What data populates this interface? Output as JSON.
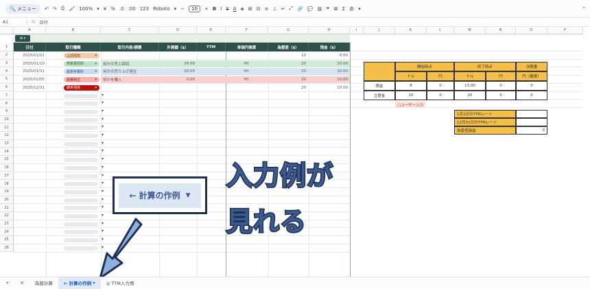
{
  "toolbar": {
    "menu_label": "メニュー",
    "zoom": "100%",
    "currency": "¥",
    "percent": "%",
    "dec_dec": ".0",
    "dec_inc": ".00",
    "number_format": "123",
    "font": "Roboto",
    "font_size": "10",
    "bold": "B",
    "italic": "I",
    "strike": "S",
    "text_color": "A",
    "sigma": "Σ",
    "input_tool": "あ"
  },
  "formula_bar": {
    "cell_ref": "A1",
    "fx": "fx",
    "value": "日付"
  },
  "columns": [
    "A",
    "B",
    "C",
    "D",
    "E",
    "F",
    "G",
    "H",
    "I",
    "J",
    "K",
    "L",
    "M",
    "N",
    "O",
    "P"
  ],
  "rows": [
    "1",
    "2",
    "3",
    "4",
    "5",
    "6",
    "7",
    "8",
    "9",
    "10",
    "11",
    "12",
    "13",
    "14",
    "15",
    "16",
    "17",
    "18",
    "19",
    "20",
    "21",
    "22",
    "23",
    "24",
    "25",
    "26"
  ],
  "headers": [
    "日付",
    "取引種類",
    "取引内容/摘要",
    "外貨額（$）",
    "TTM",
    "単価円換算",
    "為替差（$）",
    "残金（$）"
  ],
  "table": [
    {
      "date": "2025/01/01",
      "type": "以前残高",
      "desc": "",
      "amount": "",
      "ttm": "",
      "yen": "",
      "fx": "10",
      "bal": "8.00"
    },
    {
      "date": "2025/01/10",
      "type": "売掛金回収",
      "desc": "何かの売上回収",
      "amount": "16.00",
      "ttm": "",
      "yen": "¥0",
      "fx": "20",
      "bal": "10.00"
    },
    {
      "date": "2025/01/31",
      "type": "仮想手数料",
      "desc": "何かの売り上げ発生",
      "amount": "20.00",
      "ttm": "",
      "yen": "¥0",
      "fx": "20",
      "bal": "10.00"
    },
    {
      "date": "2025/02/05",
      "type": "経費発生",
      "desc": "何かを購入",
      "amount": "0.00",
      "ttm": "",
      "yen": "¥0",
      "fx": "20",
      "bal": "10.00"
    },
    {
      "date": "2025/12/31",
      "type": "期末残高",
      "desc": "",
      "amount": "",
      "ttm": "",
      "yen": "",
      "fx": "20",
      "bal": "10.00"
    }
  ],
  "summary": {
    "start": "開始時点",
    "end": "終了時点",
    "closing": "決算書",
    "dollar": "ドル",
    "yen": "円",
    "yen2": "円",
    "dollar2": "ドル",
    "yen3": "円",
    "yen_diff": "円（概算）",
    "r1": "預金",
    "r1_sd": "8",
    "r1_sy": "0",
    "r1_ed": "13.00",
    "r1_ey": "0",
    "r1_cy": "0",
    "r2": "立替金",
    "r2_sd": "10",
    "r2_sy": "0",
    "r2_ed": "20",
    "r2_ey": "0",
    "r2_cy": "0",
    "user_input": "□ユーザー入力"
  },
  "ttm": {
    "r1": "1月1日のTTMレート",
    "r2": "12月31日のTTMレート",
    "r3": "為替差損益",
    "r3_val": "0"
  },
  "dropdown_label": "← 計算の作例",
  "callout1": "入力例が",
  "callout2": "見れる",
  "tabs": {
    "add": "+",
    "list": "≡",
    "t1": "為替計算",
    "t2": "← 計算の作例",
    "t3": "◎ TTM入力用"
  }
}
